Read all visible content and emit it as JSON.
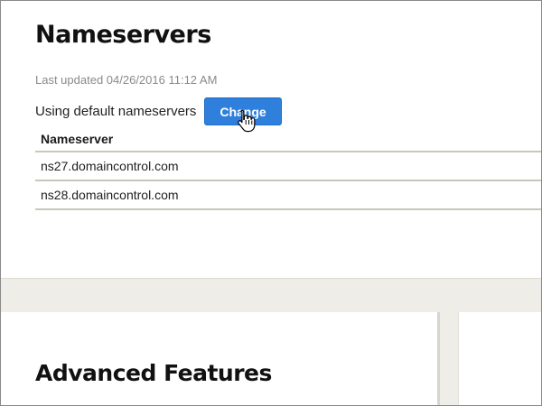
{
  "nameservers": {
    "title": "Nameservers",
    "last_updated": "Last updated 04/26/2016 11:12 AM",
    "status_text": "Using default nameservers",
    "change_label": "Change",
    "column_header": "Nameserver",
    "rows": [
      "ns27.domaincontrol.com",
      "ns28.domaincontrol.com"
    ]
  },
  "advanced": {
    "title": "Advanced Features"
  },
  "colors": {
    "accent": "#2f7fdc",
    "page_band": "#efede8",
    "divider": "#c9c6bc"
  },
  "icons": {
    "cursor": "hand-pointer-icon"
  }
}
